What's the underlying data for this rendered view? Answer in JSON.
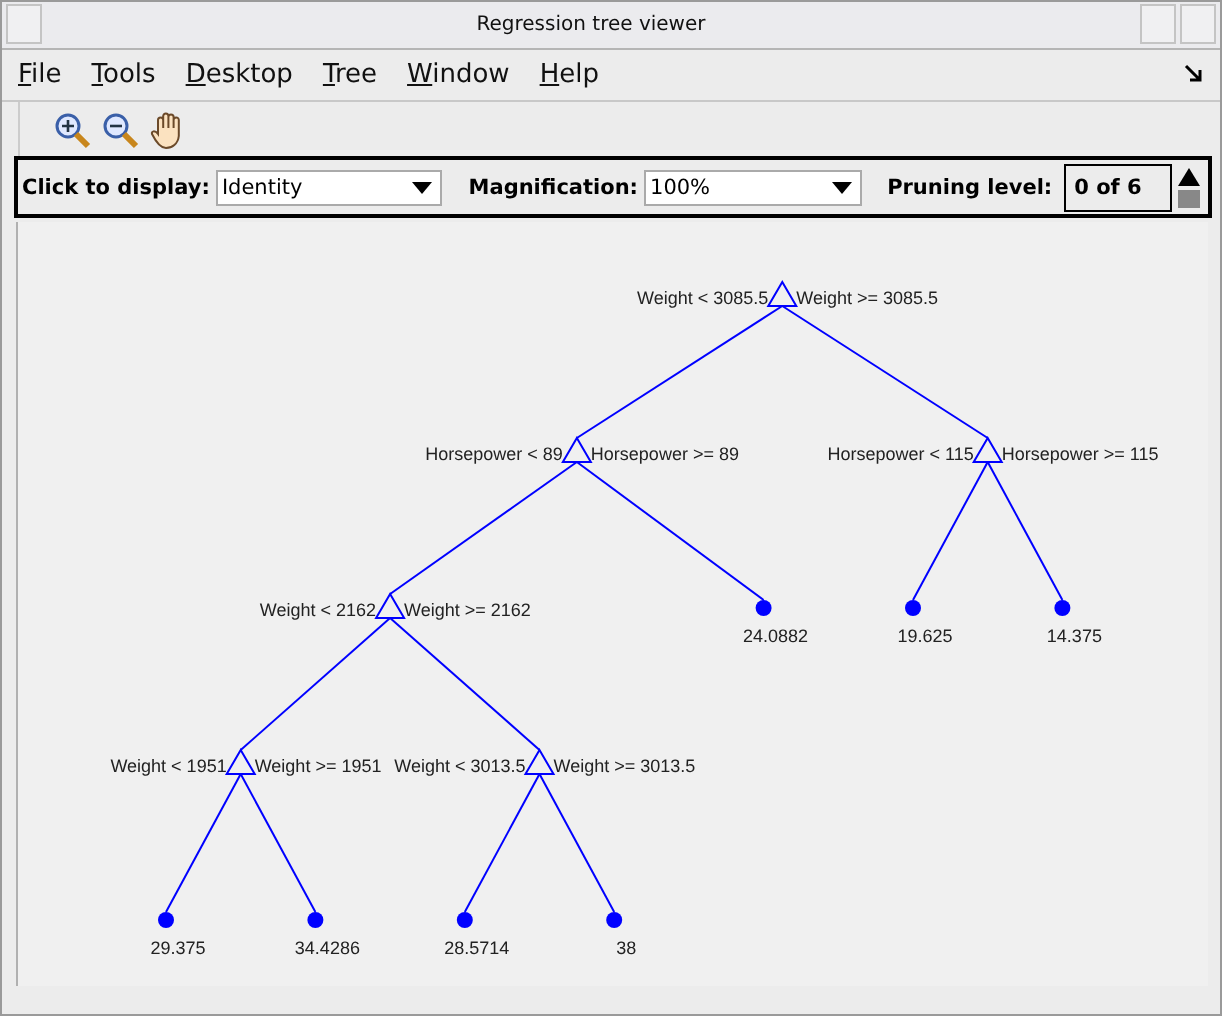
{
  "window": {
    "title": "Regression tree viewer"
  },
  "menu": [
    "File",
    "Tools",
    "Desktop",
    "Tree",
    "Window",
    "Help"
  ],
  "controls": {
    "display_label": "Click to display:",
    "display_value": "Identity",
    "magnification_label": "Magnification:",
    "magnification_value": "100%",
    "pruning_label": "Pruning level:",
    "pruning_value": "0 of 6"
  },
  "tree": {
    "kind": "split",
    "left_label": "Weight < 3085.5",
    "right_label": "Weight >= 3085.5",
    "children": [
      {
        "kind": "split",
        "left_label": "Horsepower < 89",
        "right_label": "Horsepower >= 89",
        "children": [
          {
            "kind": "split",
            "left_label": "Weight < 2162",
            "right_label": "Weight >= 2162",
            "children": [
              {
                "kind": "split",
                "left_label": "Weight < 1951",
                "right_label": "Weight >= 1951",
                "children": [
                  {
                    "kind": "leaf",
                    "value": "29.375"
                  },
                  {
                    "kind": "leaf",
                    "value": "34.4286"
                  }
                ]
              },
              {
                "kind": "split",
                "left_label": "Weight < 3013.5",
                "right_label": "Weight >= 3013.5",
                "children": [
                  {
                    "kind": "leaf",
                    "value": "28.5714"
                  },
                  {
                    "kind": "leaf",
                    "value": "38"
                  }
                ]
              }
            ]
          },
          {
            "kind": "leaf",
            "value": "24.0882"
          }
        ]
      },
      {
        "kind": "split",
        "left_label": "Horsepower < 115",
        "right_label": "Horsepower >= 115",
        "children": [
          {
            "kind": "leaf",
            "value": "19.625"
          },
          {
            "kind": "leaf",
            "value": "14.375"
          }
        ]
      }
    ]
  }
}
